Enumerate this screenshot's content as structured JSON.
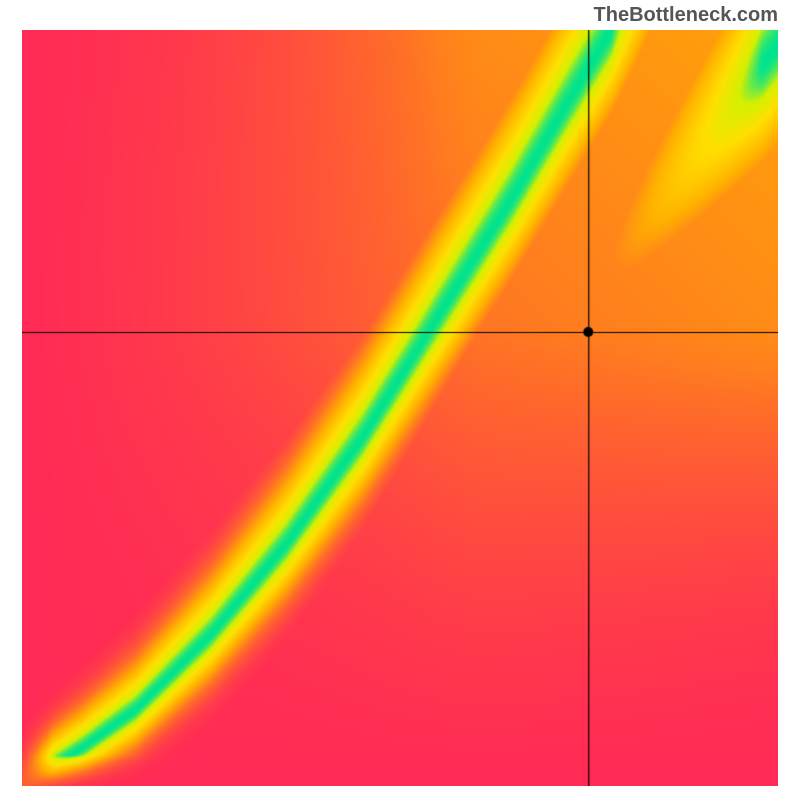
{
  "watermark": "TheBottleneck.com",
  "chart_data": {
    "type": "heatmap",
    "title": "",
    "xlabel": "",
    "ylabel": "",
    "xlim": [
      0,
      100
    ],
    "ylim": [
      0,
      100
    ],
    "grid": false,
    "crosshair": {
      "x": 75,
      "y": 60
    },
    "marker": {
      "x": 75,
      "y": 60,
      "shape": "circle",
      "color": "#000000"
    },
    "ridge": {
      "description": "Optimal balance curve (green ridge) from bottom-left to top-right; deviation increases toward red.",
      "points": [
        {
          "x": 0,
          "y": 0
        },
        {
          "x": 8,
          "y": 5
        },
        {
          "x": 15,
          "y": 10
        },
        {
          "x": 25,
          "y": 20
        },
        {
          "x": 35,
          "y": 32
        },
        {
          "x": 45,
          "y": 46
        },
        {
          "x": 55,
          "y": 62
        },
        {
          "x": 65,
          "y": 78
        },
        {
          "x": 72,
          "y": 90
        },
        {
          "x": 78,
          "y": 100
        }
      ]
    },
    "upper_ridge": {
      "points": [
        {
          "x": 70,
          "y": 60
        },
        {
          "x": 80,
          "y": 72
        },
        {
          "x": 90,
          "y": 85
        },
        {
          "x": 100,
          "y": 98
        }
      ]
    },
    "colorscale": [
      {
        "t": 0.0,
        "color": "#ff2a55"
      },
      {
        "t": 0.25,
        "color": "#ff6a2a"
      },
      {
        "t": 0.5,
        "color": "#ffb000"
      },
      {
        "t": 0.75,
        "color": "#ffe000"
      },
      {
        "t": 0.9,
        "color": "#d4f000"
      },
      {
        "t": 1.0,
        "color": "#00e38f"
      }
    ]
  }
}
